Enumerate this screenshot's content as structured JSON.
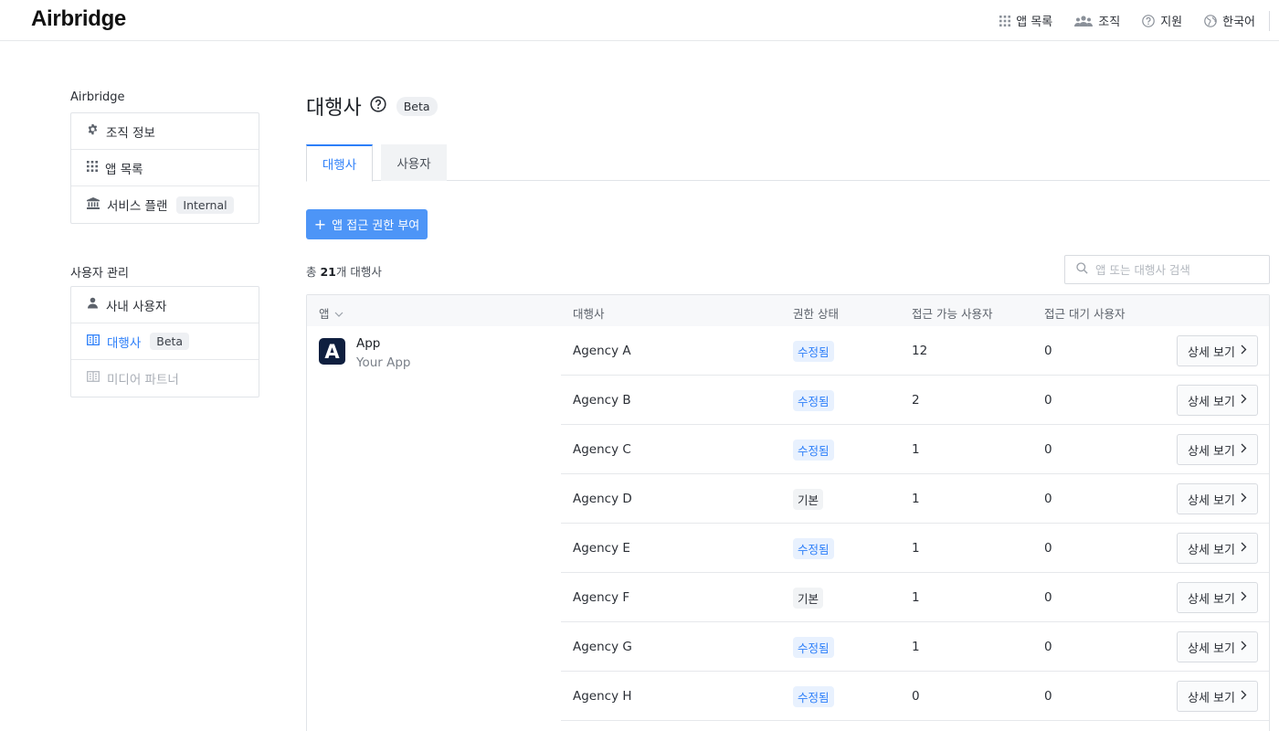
{
  "header": {
    "logo": "Airbridge",
    "nav": [
      {
        "label": "앱 목록",
        "icon": "grid-icon"
      },
      {
        "label": "조직",
        "icon": "people-icon"
      },
      {
        "label": "지원",
        "icon": "help-circle-icon"
      },
      {
        "label": "한국어",
        "icon": "globe-icon"
      }
    ]
  },
  "sidebar": {
    "org_heading": "Airbridge",
    "org_items": [
      {
        "label": "조직 정보",
        "icon": "gear-icon"
      },
      {
        "label": "앱 목록",
        "icon": "grid-icon"
      },
      {
        "label": "서비스 플랜",
        "icon": "bank-icon",
        "badge": "Internal"
      }
    ],
    "user_heading": "사용자 관리",
    "user_items": [
      {
        "label": "사내 사용자",
        "icon": "person-icon"
      },
      {
        "label": "대행사",
        "icon": "building-icon",
        "badge": "Beta",
        "active": true
      },
      {
        "label": "미디어 파트너",
        "icon": "building-icon",
        "disabled": true
      }
    ]
  },
  "main": {
    "title": "대행사",
    "title_badge": "Beta",
    "tabs": [
      {
        "label": "대행사",
        "active": true
      },
      {
        "label": "사용자",
        "active": false
      }
    ],
    "grant_button": "앱 접근 권한 부여",
    "total_prefix": "총 ",
    "total_count": "21",
    "total_suffix": "개 대행사",
    "search_placeholder": "앱 또는 대행사 검색",
    "accent_color": "#2d7ff9"
  },
  "table": {
    "columns": [
      "앱",
      "대행사",
      "권한 상태",
      "접근 가능 사용자",
      "접근 대기 사용자"
    ],
    "app": {
      "icon_letter": "A",
      "name": "App",
      "subtitle": "Your App"
    },
    "detail_label": "상세 보기",
    "rows": [
      {
        "agency": "Agency A",
        "status": "수정됨",
        "status_type": "modified",
        "accessible": "12",
        "pending": "0"
      },
      {
        "agency": "Agency B",
        "status": "수정됨",
        "status_type": "modified",
        "accessible": "2",
        "pending": "0"
      },
      {
        "agency": "Agency C",
        "status": "수정됨",
        "status_type": "modified",
        "accessible": "1",
        "pending": "0"
      },
      {
        "agency": "Agency D",
        "status": "기본",
        "status_type": "default",
        "accessible": "1",
        "pending": "0"
      },
      {
        "agency": "Agency E",
        "status": "수정됨",
        "status_type": "modified",
        "accessible": "1",
        "pending": "0"
      },
      {
        "agency": "Agency F",
        "status": "기본",
        "status_type": "default",
        "accessible": "1",
        "pending": "0"
      },
      {
        "agency": "Agency G",
        "status": "수정됨",
        "status_type": "modified",
        "accessible": "1",
        "pending": "0"
      },
      {
        "agency": "Agency H",
        "status": "수정됨",
        "status_type": "modified",
        "accessible": "0",
        "pending": "0"
      }
    ]
  }
}
